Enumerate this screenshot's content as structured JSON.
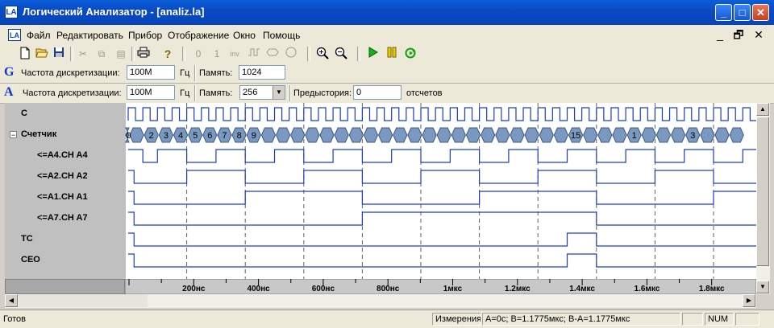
{
  "window": {
    "title": "Логический Анализатор - [analiz.la]",
    "app_icon": "LA",
    "controls": {
      "minimize": "_",
      "maximize": "□",
      "close": "✕"
    }
  },
  "menu": {
    "items": [
      "Файл",
      "Редактировать",
      "Прибор",
      "Отображение",
      "Окно",
      "Помощь"
    ],
    "mdi_controls": {
      "minimize": "_",
      "restore": "🗗",
      "close": "✕"
    }
  },
  "toolbar": {
    "buttons": [
      "new-icon",
      "open-icon",
      "save-icon",
      "cut-icon",
      "copy-icon",
      "paste-icon",
      "print-icon",
      "help-icon",
      "zero",
      "one",
      "inv",
      "pulse",
      "bus",
      "n",
      "zoom-in-icon",
      "zoom-out-icon",
      "run-icon",
      "pause-icon",
      "loop-icon"
    ],
    "labels": {
      "zero": "0",
      "one": "1",
      "inv": "inv",
      "n": "N"
    }
  },
  "config_g": {
    "letter": "G",
    "freq_label": "Частота дискретизации:",
    "freq_value": "100M",
    "freq_unit": "Гц",
    "mem_label": "Память:",
    "mem_value": "1024"
  },
  "config_a": {
    "letter": "A",
    "freq_label": "Частота дискретизации:",
    "freq_value": "100M",
    "freq_unit": "Гц",
    "mem_label": "Память:",
    "mem_value": "256",
    "pre_label": "Предыстория:",
    "pre_value": "0",
    "pre_unit": "отсчетов"
  },
  "signals": [
    {
      "name": "C",
      "type": "clock"
    },
    {
      "name": "Счетчик",
      "type": "bus",
      "expanded": true
    },
    {
      "name": "<=A4.CH A4",
      "type": "digital"
    },
    {
      "name": "<=A2.CH A2",
      "type": "digital"
    },
    {
      "name": "<=A1.CH A1",
      "type": "digital"
    },
    {
      "name": "<=A7.CH A7",
      "type": "digital"
    },
    {
      "name": "TC",
      "type": "digital"
    },
    {
      "name": "CEO",
      "type": "digital"
    }
  ],
  "bus_labels": [
    "0",
    "2",
    "3",
    "4",
    "5",
    "6",
    "7",
    "8",
    "9",
    "15",
    "1",
    "3"
  ],
  "ruler": {
    "ticks": [
      "200нс",
      "400нс",
      "600нс",
      "800нс",
      "1мкс",
      "1.2мкс",
      "1.4мкс",
      "1.6мкс",
      "1.8мкс"
    ]
  },
  "status": {
    "ready": "Готов",
    "measure_label": "Измерения",
    "measure_value": "A=0с; B=1.1775мкс; B-A=1.1775мкс",
    "num": "NUM"
  },
  "colors": {
    "titlebar": "#0b49c6",
    "wave": "#1a3ad0",
    "bus_fill": "#7a98c0",
    "cursor": "#606060",
    "wave_bg": "#ffffff",
    "names_bg": "#c0c0c0"
  }
}
